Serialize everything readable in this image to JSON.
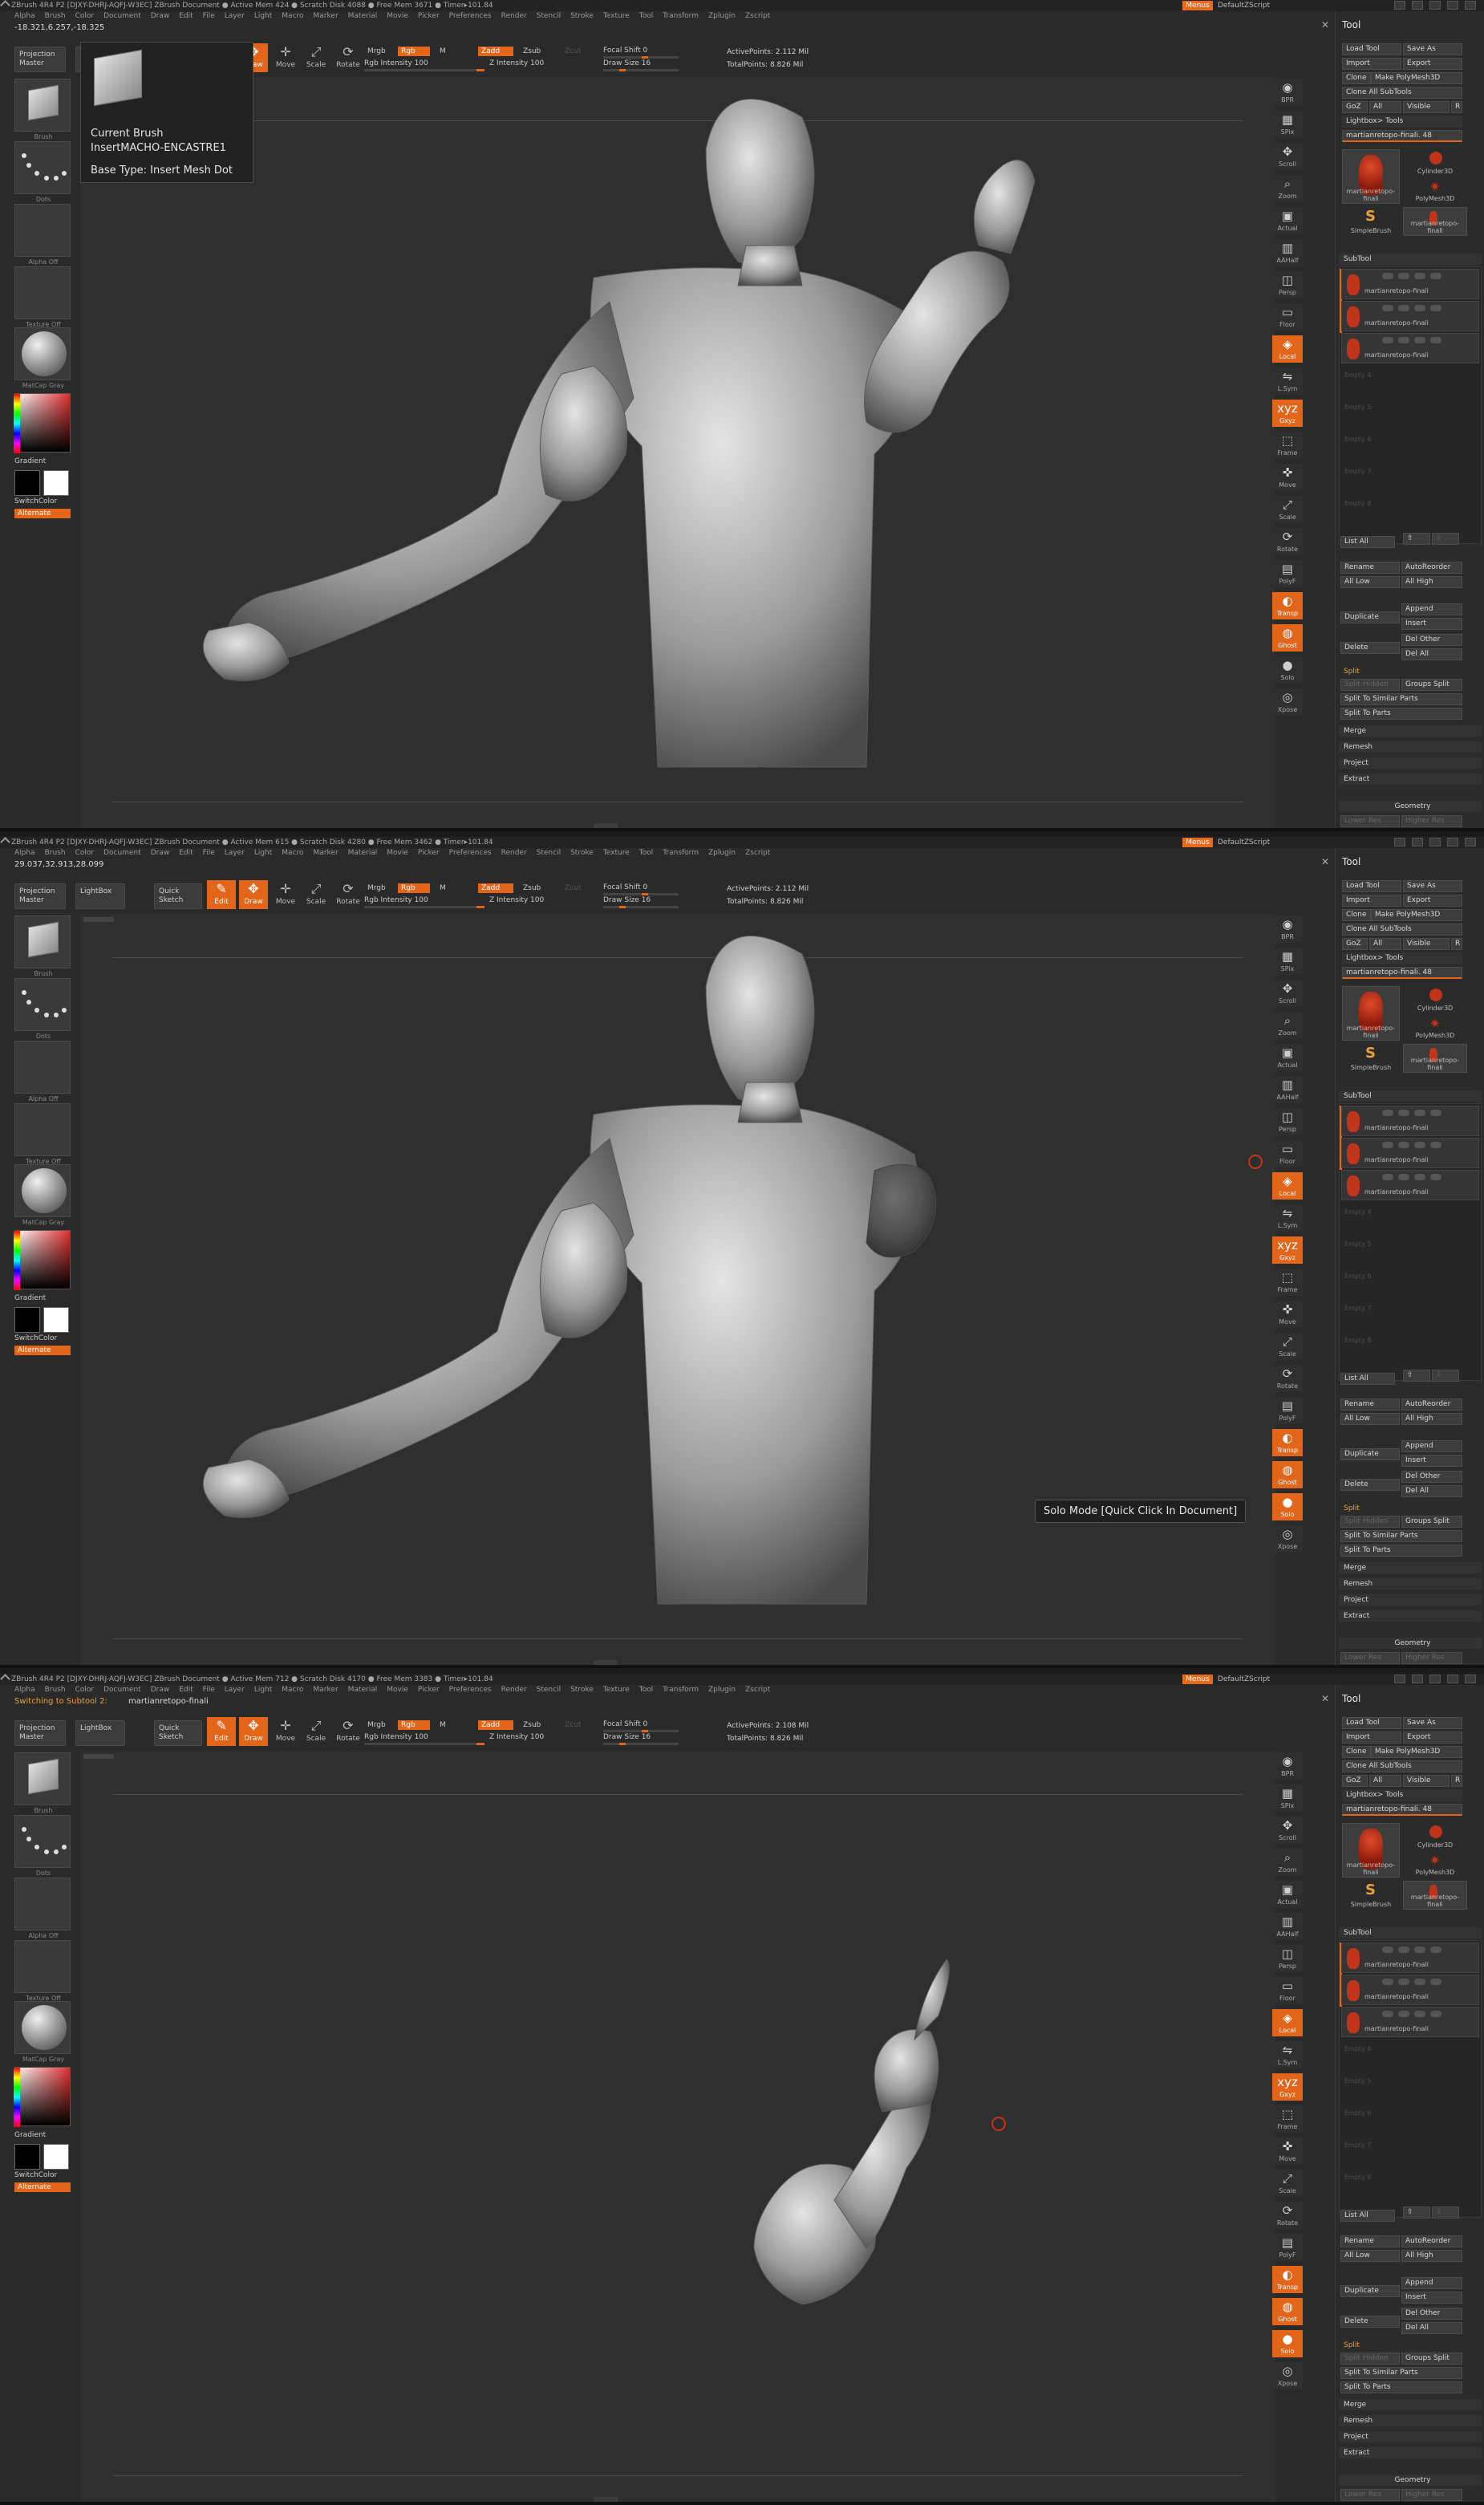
{
  "colors": {
    "accent": "#e2651a",
    "panel": "#2b2b2b",
    "viewport": "#2f2f2f",
    "text": "#c8c8c8"
  },
  "menus_label": "Menus",
  "script_label": "DefaultZScript",
  "menubar": [
    "Alpha",
    "Brush",
    "Color",
    "Document",
    "Draw",
    "Edit",
    "File",
    "Layer",
    "Light",
    "Macro",
    "Marker",
    "Material",
    "Movie",
    "Picker",
    "Preferences",
    "Render",
    "Stencil",
    "Stroke",
    "Texture",
    "Tool",
    "Transform",
    "Zplugin",
    "Zscript"
  ],
  "toolbar": {
    "projection_master": "Projection Master",
    "lightbox": "LightBox",
    "quick_sketch": "Quick Sketch",
    "edit": "Edit",
    "draw": "Draw",
    "move": "Move",
    "scale": "Scale",
    "rotate": "Rotate",
    "mrgb": "Mrgb",
    "rgb": "Rgb",
    "m": "M",
    "rgb_intensity": "Rgb Intensity 100",
    "zadd": "Zadd",
    "zsub": "Zsub",
    "zcut": "Zcut",
    "z_intensity": "Z Intensity 100",
    "focal_shift": "Focal Shift 0",
    "draw_size": "Draw Size 16",
    "active_points_label": "ActivePoints:",
    "total_points": "TotalPoints: 8.826 Mil"
  },
  "left_shelf": {
    "brush_label": "Brush",
    "dots_label": "Dots",
    "alpha_label": "Alpha Off",
    "texture_label": "Texture Off",
    "material_label": "MatCap Gray",
    "gradient": "Gradient",
    "switch_color": "SwitchColor",
    "alternate": "Alternate"
  },
  "right_shelf": [
    "BPR",
    "SPix",
    "Scroll",
    "Zoom",
    "Actual",
    "AAHalf",
    "Persp",
    "Floor",
    "Local",
    "L.Sym",
    "Gxyz",
    "Frame",
    "Move",
    "Scale",
    "Rotate",
    "PolyF",
    "Transp",
    "Ghost",
    "Solo",
    "Xpose"
  ],
  "tool_panel": {
    "title": "Tool",
    "load_tool": "Load Tool",
    "save_as": "Save As",
    "import": "Import",
    "export": "Export",
    "clone": "Clone",
    "make_polymesh": "Make PolyMesh3D",
    "clone_all_subtools": "Clone All SubTools",
    "goz": "GoZ",
    "all": "All",
    "visible": "Visible",
    "r": "R",
    "lightbox_tools": "Lightbox> Tools",
    "current_tool": "martianretopo-finali. 48",
    "thumbs": [
      "martianretopo-finali",
      "Cylinder3D",
      "PolyMesh3D",
      "SimpleBrush",
      "martianretopo-finali"
    ],
    "subtool_header": "SubTool",
    "subtools": [
      "martianretopo-finali",
      "martianretopo-finali",
      "martianretopo-finali"
    ],
    "empty_slots": [
      "Empty 4",
      "Empty 5",
      "Empty 6",
      "Empty 7",
      "Empty 8"
    ],
    "list_all": "List All",
    "rename": "Rename",
    "autoreorder": "AutoReorder",
    "all_low": "All Low",
    "all_high": "All High",
    "duplicate": "Duplicate",
    "append": "Append",
    "insert": "Insert",
    "delete": "Delete",
    "del_other": "Del Other",
    "del_all": "Del All",
    "split": "Split",
    "split_hidden": "Split Hidden",
    "groups_split": "Groups Split",
    "split_similar": "Split To Similar Parts",
    "split_parts": "Split To Parts",
    "merge": "Merge",
    "remesh": "Remesh",
    "project": "Project",
    "extract": "Extract",
    "geometry": "Geometry",
    "lower_res": "Lower Res",
    "higher_res": "Higher Res"
  },
  "panes": [
    {
      "title": "ZBrush 4R4 P2 [DJXY-DHRJ-AQFJ-W3EC]   ZBrush Document   ● Active Mem 424 ● Scratch Disk 4088 ● Free Mem 3671 ● Timer▸101.84",
      "notice": "-18.321,6.257,-18.325",
      "active_points": "ActivePoints: 2.112 Mil",
      "brush_tip": {
        "line1": "Current Brush",
        "line2": "InsertMACHO-ENCASTRE1",
        "line3": "Base Type: Insert Mesh Dot"
      }
    },
    {
      "title": "ZBrush 4R4 P2 [DJXY-DHRJ-AQFJ-W3EC]   ZBrush Document   ● Active Mem 615 ● Scratch Disk 4280 ● Free Mem 3462 ● Timer▸101.84",
      "notice": "29.037,32.913,28.099",
      "active_points": "ActivePoints: 2.112 Mil",
      "tooltip": "Solo Mode [Quick Click In Document]"
    },
    {
      "title": "ZBrush 4R4 P2 [DJXY-DHRJ-AQFJ-W3EC]   ZBrush Document   ● Active Mem 712 ● Scratch Disk 4170 ● Free Mem 3383 ● Timer▸101.84",
      "notice_prefix": "Switching to Subtool 2:",
      "notice": "martianretopo-finali",
      "active_points": "ActivePoints: 2.108 Mil"
    }
  ]
}
